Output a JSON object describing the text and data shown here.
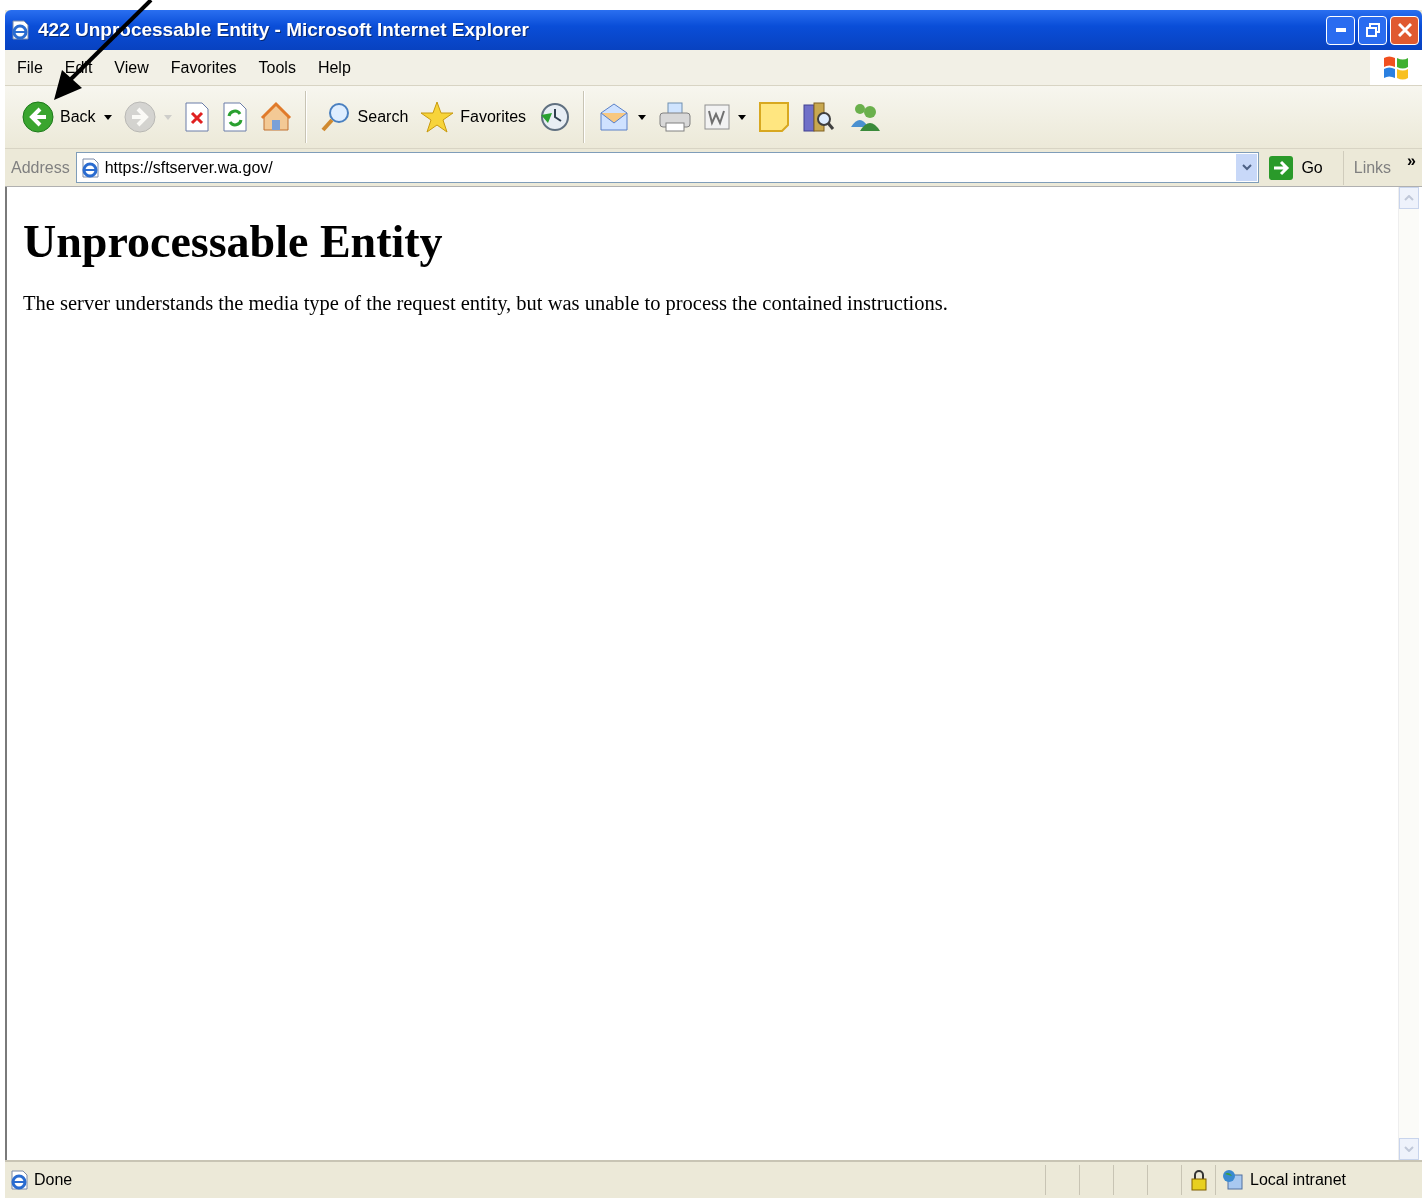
{
  "window": {
    "title": "422 Unprocessable Entity - Microsoft Internet Explorer"
  },
  "menu": [
    "File",
    "Edit",
    "View",
    "Favorites",
    "Tools",
    "Help"
  ],
  "toolbar": [
    {
      "kind": "back",
      "label": "Back",
      "dropdown": true,
      "disabled": false
    },
    {
      "kind": "forward",
      "dropdown": true,
      "disabled": true
    },
    {
      "kind": "stop",
      "dropdown": false,
      "disabled": false
    },
    {
      "kind": "refresh",
      "dropdown": false,
      "disabled": false
    },
    {
      "kind": "home",
      "dropdown": false,
      "disabled": false
    },
    {
      "kind": "separator"
    },
    {
      "kind": "search",
      "label": "Search",
      "dropdown": false,
      "disabled": false
    },
    {
      "kind": "favorites",
      "label": "Favorites",
      "dropdown": false,
      "disabled": false
    },
    {
      "kind": "history",
      "dropdown": false,
      "disabled": false
    },
    {
      "kind": "separator"
    },
    {
      "kind": "mail",
      "dropdown": true,
      "disabled": false
    },
    {
      "kind": "print",
      "dropdown": false,
      "disabled": false
    },
    {
      "kind": "edit",
      "dropdown": true,
      "disabled": false
    },
    {
      "kind": "note",
      "dropdown": false,
      "disabled": false
    },
    {
      "kind": "research",
      "dropdown": false,
      "disabled": false
    },
    {
      "kind": "messenger",
      "dropdown": false,
      "disabled": false
    }
  ],
  "address": {
    "label": "Address",
    "value": "https://sftserver.wa.gov/",
    "go": "Go",
    "links": "Links",
    "more": "»"
  },
  "page": {
    "heading": "Unprocessable Entity",
    "body": "The server understands the media type of the request entity, but was unable to process the contained instructions."
  },
  "status_bar": {
    "text": "Done",
    "zone": "Local intranet"
  }
}
